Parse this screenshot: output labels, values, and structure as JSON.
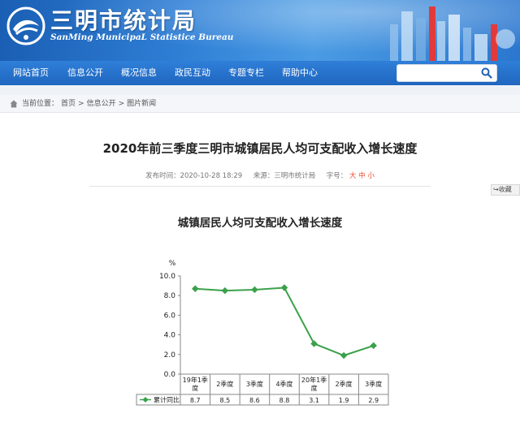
{
  "site": {
    "title": "三明市统计局",
    "subtitle": "SanMing MunicipaL Statistice Bureau"
  },
  "nav": {
    "items": [
      {
        "label": "网站首页"
      },
      {
        "label": "信息公开"
      },
      {
        "label": "概况信息"
      },
      {
        "label": "政民互动"
      },
      {
        "label": "专题专栏"
      },
      {
        "label": "帮助中心"
      }
    ],
    "search": {
      "value": "",
      "placeholder": ""
    }
  },
  "breadcrumb": {
    "prefix": "当前位置：",
    "items": [
      "首页",
      ">",
      "信息公开",
      ">",
      "图片新闻"
    ]
  },
  "article": {
    "title": "2020年前三季度三明市城镇居民人均可支配收入增长速度",
    "publish_label": "发布时间：2020-10-28 18:29",
    "source_label": "来源：三明市统计局",
    "font_label": "字号：",
    "font_large": "大",
    "font_medium": "中",
    "font_small": "小",
    "favorite": "收藏"
  },
  "chart_data": {
    "type": "line",
    "title": "城镇居民人均可支配收入增长速度",
    "unit": "%",
    "categories": [
      [
        "19年1季",
        "度"
      ],
      [
        "2季度"
      ],
      [
        "3季度"
      ],
      [
        "4季度"
      ],
      [
        "20年1季",
        "度"
      ],
      [
        "2季度"
      ],
      [
        "3季度"
      ]
    ],
    "series": [
      {
        "name": "累计同比",
        "values": [
          8.7,
          8.5,
          8.6,
          8.8,
          3.1,
          1.9,
          2.9
        ],
        "value_labels": [
          "8.7",
          "8.5",
          "8.6",
          "8.8",
          "3.1",
          "1.9",
          "2.9"
        ],
        "color": "#3aa14a"
      }
    ],
    "yticks": [
      "10.0",
      "8.0",
      "6.0",
      "4.0",
      "2.0",
      "0.0"
    ],
    "ylim": [
      0,
      10
    ],
    "grid": false,
    "legend": "data-table"
  },
  "colors": {
    "nav": "#2371c8",
    "series": "#3aa14a",
    "font_size_link": "#e94c2f"
  }
}
